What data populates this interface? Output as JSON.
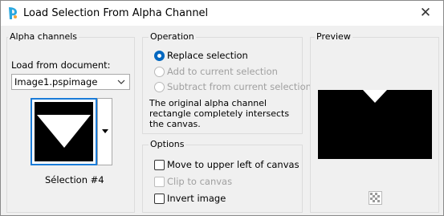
{
  "window": {
    "title": "Load Selection From Alpha Channel",
    "close_glyph": "✕",
    "icons": {
      "app": "paintshop-pro-icon",
      "close": "close-icon"
    }
  },
  "alpha_channels": {
    "title": "Alpha channels",
    "load_label": "Load from document:",
    "document": "Image1.pspimage",
    "selection_name": "Sélection #4"
  },
  "operation": {
    "title": "Operation",
    "options": [
      {
        "label": "Replace selection",
        "selected": true,
        "enabled": true
      },
      {
        "label": "Add to current selection",
        "selected": false,
        "enabled": false
      },
      {
        "label": "Subtract from current selection",
        "selected": false,
        "enabled": false
      }
    ],
    "description": "The original alpha channel rectangle completely intersects the canvas."
  },
  "options": {
    "title": "Options",
    "items": [
      {
        "label": "Move to upper left of canvas",
        "checked": false,
        "enabled": true
      },
      {
        "label": "Clip to canvas",
        "checked": false,
        "enabled": false
      },
      {
        "label": "Invert image",
        "checked": false,
        "enabled": true
      }
    ]
  },
  "preview": {
    "title": "Preview",
    "toggle_icon": "checkerboard-icon"
  },
  "colors": {
    "accent": "#0067c0",
    "selection_border": "#1a7bd8",
    "disabled": "#a0a0a0"
  }
}
